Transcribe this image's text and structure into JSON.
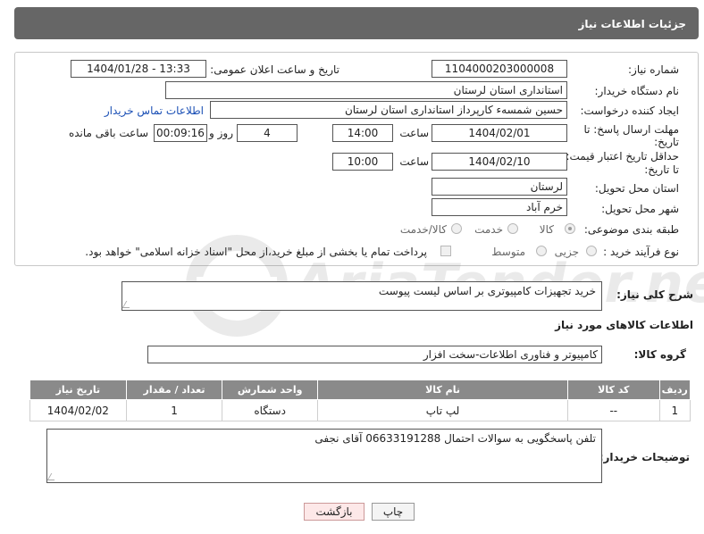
{
  "header": {
    "title": "جزئیات اطلاعات نیاز"
  },
  "form": {
    "need_number_label": "شماره نیاز:",
    "need_number": "1104000203000008",
    "announce_label": "تاریخ و ساعت اعلان عمومی:",
    "announce_value": "1404/01/28 - 13:33",
    "buyer_org_label": "نام دستگاه خریدار:",
    "buyer_org": "استانداری استان لرستان",
    "creator_label": "ایجاد کننده درخواست:",
    "creator": "حسین شمسه‌ء کارپرداز استانداری استان لرستان",
    "buyer_contact_link": "اطلاعات تماس خریدار",
    "deadline_label_1": "مهلت ارسال پاسخ: تا",
    "deadline_label_2": "تاریخ:",
    "deadline_date": "1404/02/01",
    "time_label": "ساعت",
    "deadline_time": "14:00",
    "days_value": "4",
    "day_and_label": "روز و",
    "remaining_time": "00:09:16",
    "remaining_label": "ساعت باقی مانده",
    "price_label_1": "حداقل تاریخ اعتبار قیمت:",
    "price_label_2": "تا تاریخ:",
    "price_date": "1404/02/10",
    "price_time_label": "ساعت",
    "price_time": "10:00",
    "province_label": "استان محل تحویل:",
    "province": "لرستان",
    "city_label": "شهر محل تحویل:",
    "city": "خرم آباد",
    "category_label": "طبقه بندی موضوعی:",
    "category_options": [
      "کالا",
      "خدمت",
      "کالا/خدمت"
    ],
    "process_label": "نوع فرآیند خرید :",
    "process_options": [
      "جزیی",
      "متوسط"
    ],
    "payment_note": "پرداخت تمام یا بخشی از مبلغ خرید،از محل \"اسناد خزانه اسلامی\" خواهد بود."
  },
  "description": {
    "label": "شرح کلی نیاز:",
    "value": "خرید تجهیزات کامپیوتری بر اساس لیست پیوست"
  },
  "goods_section_title": "اطلاعات کالاهای مورد نیاز",
  "goods_group": {
    "label": "گروه کالا:",
    "value": "کامپیوتر و فناوری اطلاعات-سخت افزار"
  },
  "table": {
    "headers": [
      "ردیف",
      "کد کالا",
      "نام کالا",
      "واحد شمارش",
      "تعداد / مقدار",
      "تاریخ نیاز"
    ],
    "rows": [
      [
        "1",
        "--",
        "لپ تاپ",
        "دستگاه",
        "1",
        "1404/02/02"
      ]
    ]
  },
  "buyer_notes": {
    "label": "توضیحات خریدار:",
    "value": "تلفن پاسخگویی به سوالات احتمال 06633191288 آقای نجفی"
  },
  "buttons": {
    "print": "چاپ",
    "back": "بازگشت"
  },
  "watermark": {
    "text": "AriaTender.net"
  },
  "colors": {
    "header_bg": "#666666",
    "link": "#1a4fb5",
    "table_header_bg": "#8a8a8a",
    "back_button_bg": "#fde8e8"
  }
}
